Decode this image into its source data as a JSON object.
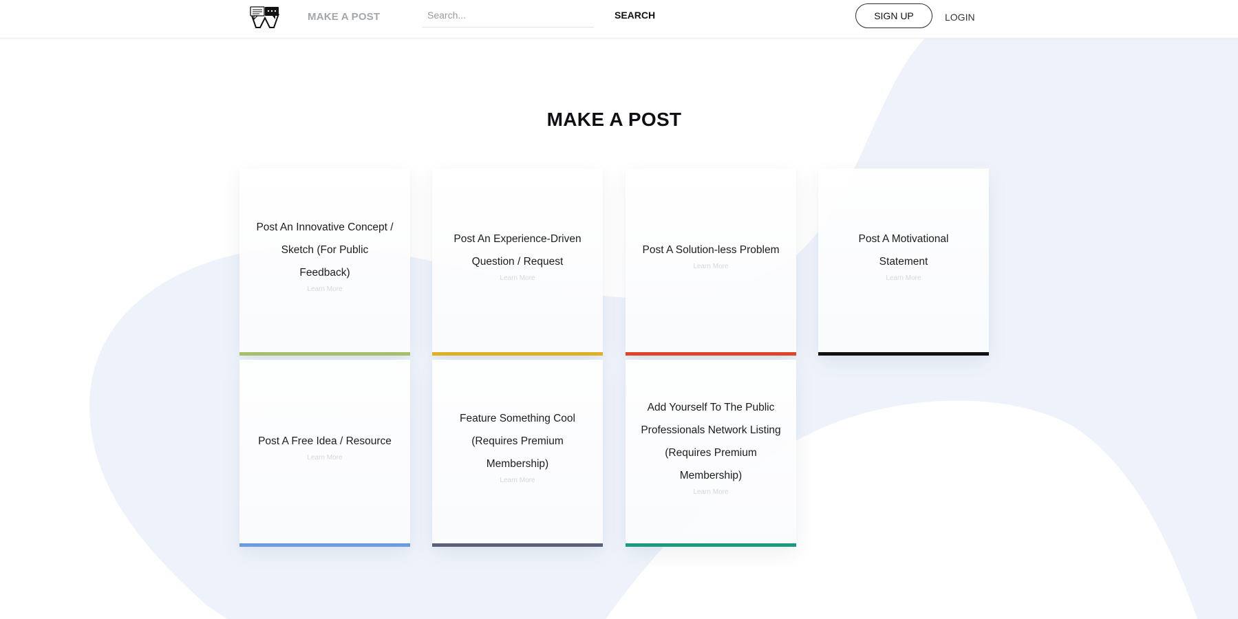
{
  "header": {
    "logo_icon": "speech-bubbles-logo-icon",
    "nav_make_post": "MAKE A POST",
    "search_placeholder": "Search...",
    "search_button": "SEARCH",
    "signup_button": "SIGN UP",
    "login_link": "LOGIN"
  },
  "main": {
    "title": "MAKE A POST",
    "cards": [
      {
        "title": "Post An Innovative Concept / Sketch (For Public Feedback)",
        "link": "Learn More",
        "accent": "#a8c06c"
      },
      {
        "title": "Post An Experience-Driven Question / Request",
        "link": "Learn More",
        "accent": "#e0b025"
      },
      {
        "title": "Post A Solution-less Problem",
        "link": "Learn More",
        "accent": "#e0452a"
      },
      {
        "title": "Post A Motivational Statement",
        "link": "Learn More",
        "accent": "#111111"
      },
      {
        "title": "Post A Free Idea / Resource",
        "link": "Learn More",
        "accent": "#6b9be4"
      },
      {
        "title": "Feature Something Cool (Requires Premium Membership)",
        "link": "Learn More",
        "accent": "#5a6078"
      },
      {
        "title": "Add Yourself To The Public Professionals Network Listing (Requires Premium Membership)",
        "link": "Learn More",
        "accent": "#1b9a7e"
      }
    ]
  },
  "colors": {
    "background_blob": "#eef3fb",
    "nav_muted": "#a3a7ad"
  }
}
